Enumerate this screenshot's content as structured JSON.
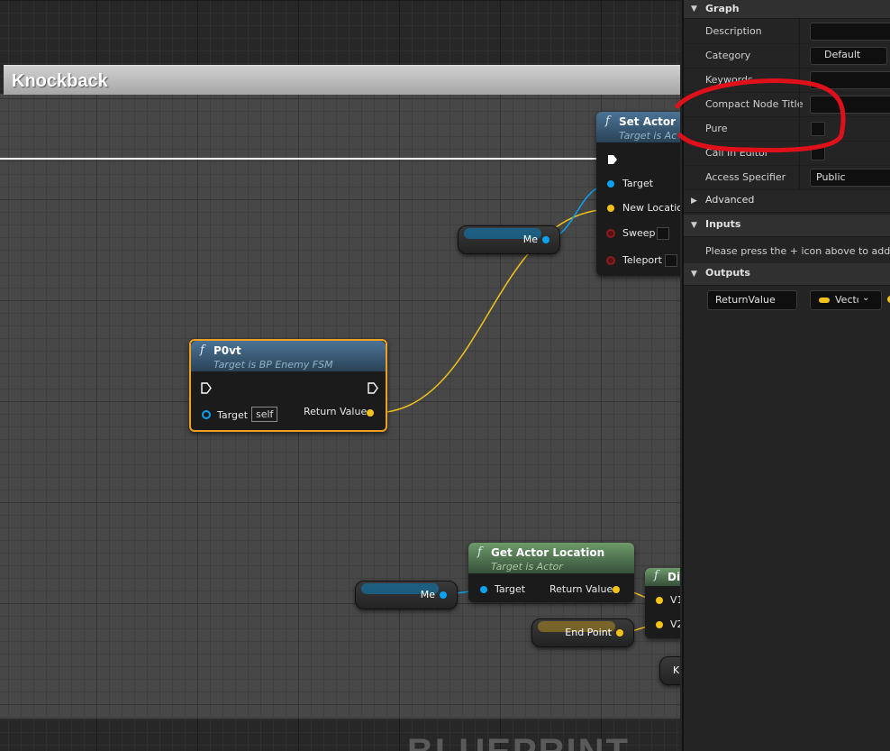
{
  "comment": {
    "title": "Knockback"
  },
  "watermark": "BLUEPRINT",
  "nodes": {
    "set_actor": {
      "icon": "f",
      "title": "Set Actor L",
      "subtitle": "Target is Ac",
      "pins": [
        "Target",
        "New Location",
        "Sweep",
        "Teleport"
      ]
    },
    "pOvt": {
      "icon": "f",
      "title": "P0vt",
      "subtitle": "Target is BP Enemy FSM",
      "target_label": "Target",
      "target_value": "self",
      "return_label": "Return Value"
    },
    "get_actor_location": {
      "icon": "f",
      "title": "Get Actor Location",
      "subtitle": "Target is Actor",
      "target_label": "Target",
      "return_label": "Return Value"
    },
    "distance": {
      "icon": "f",
      "title": "Dis",
      "pins": [
        "V1",
        "V2"
      ]
    },
    "me_top": {
      "label": "Me"
    },
    "me_bottom": {
      "label": "Me"
    },
    "end_point": {
      "label": "End Point"
    },
    "k_node": {
      "label": "K"
    }
  },
  "panel": {
    "graph_section": "Graph",
    "rows": {
      "description": "Description",
      "category": "Category",
      "category_value": "Default",
      "keywords": "Keywords",
      "compact_title": "Compact Node Title",
      "pure": "Pure",
      "call_in_editor": "Call In Editor",
      "access_specifier": "Access Specifier",
      "access_value": "Public"
    },
    "advanced_section": "Advanced",
    "inputs_section": "Inputs",
    "inputs_note": "Please press the + icon above to add para",
    "outputs_section": "Outputs",
    "output_name": "ReturnValue",
    "output_type": "Vecto"
  },
  "colors": {
    "annotation": "#e0101a",
    "float_pin": "#f4c21b",
    "object_pin": "#0aa3f0",
    "bool_pin": "#8a1d1d"
  }
}
